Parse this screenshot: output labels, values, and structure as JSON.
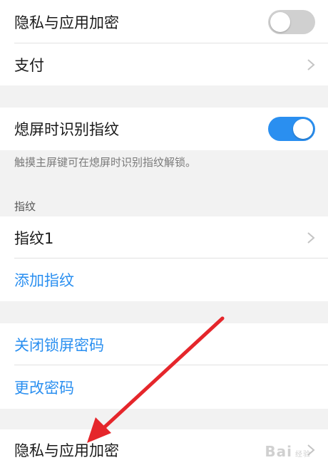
{
  "rows": {
    "privacy_top": {
      "label": "隐私与应用加密",
      "toggle": "off"
    },
    "payment": {
      "label": "支付"
    },
    "screen_off_fp": {
      "label": "熄屏时识别指纹",
      "toggle": "on"
    },
    "screen_off_note": "触摸主屏键可在熄屏时识别指纹解锁。",
    "fingerprint_section_title": "指纹",
    "fingerprint1": {
      "label": "指纹1"
    },
    "add_fingerprint": {
      "label": "添加指纹"
    },
    "close_lock_password": {
      "label": "关闭锁屏密码"
    },
    "change_password": {
      "label": "更改密码"
    },
    "privacy_bottom": {
      "label": "隐私与应用加密"
    }
  },
  "colors": {
    "accent": "#2a8ff0",
    "annotation_arrow": "#e5262b"
  },
  "watermark": {
    "text": "Bai",
    "sub": "经验"
  }
}
